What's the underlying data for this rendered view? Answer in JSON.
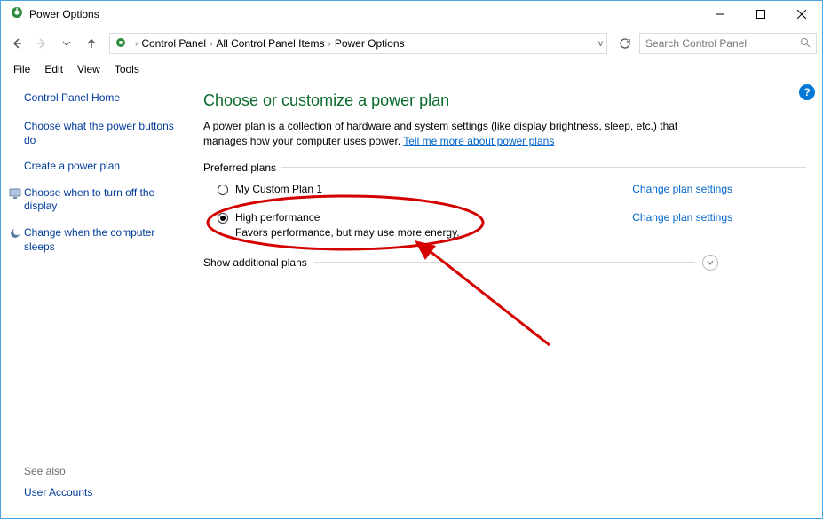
{
  "window": {
    "title": "Power Options"
  },
  "nav": {
    "breadcrumb": {
      "root": "Control Panel",
      "mid": "All Control Panel Items",
      "leaf": "Power Options"
    },
    "search_placeholder": "Search Control Panel"
  },
  "menu": {
    "file": "File",
    "edit": "Edit",
    "view": "View",
    "tools": "Tools"
  },
  "sidebar": {
    "home": "Control Panel Home",
    "links": [
      "Choose what the power buttons do",
      "Create a power plan",
      "Choose when to turn off the display",
      "Change when the computer sleeps"
    ],
    "seealso_label": "See also",
    "seealso_link": "User Accounts"
  },
  "main": {
    "heading": "Choose or customize a power plan",
    "desc_pre": "A power plan is a collection of hardware and system settings (like display brightness, sleep, etc.) that manages how your computer uses power. ",
    "desc_link": "Tell me more about power plans",
    "preferred_label": "Preferred plans",
    "plans": [
      {
        "name": "My Custom Plan 1",
        "desc": "",
        "selected": false,
        "settings": "Change plan settings"
      },
      {
        "name": "High performance",
        "desc": "Favors performance, but may use more energy.",
        "selected": true,
        "settings": "Change plan settings"
      }
    ],
    "show_additional": "Show additional plans"
  }
}
